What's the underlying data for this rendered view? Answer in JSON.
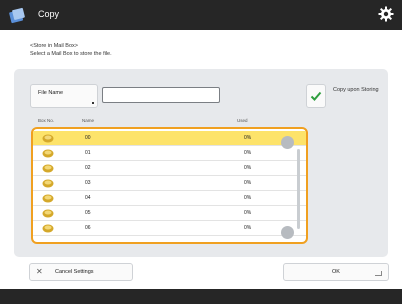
{
  "header": {
    "title": "Copy",
    "icon": "copy-app-icon",
    "settings_icon": "gear-icon"
  },
  "breadcrumb": "<Store in Mail Box>",
  "instruction": "Select a Mail Box to store the file.",
  "file_name": {
    "button_label": "File Name",
    "value": ""
  },
  "copy_upon_storing": {
    "label": "Copy upon Storing",
    "checked": true
  },
  "table": {
    "headers": {
      "box_no": "Box No.",
      "name": "Name",
      "used": "Used"
    },
    "rows": [
      {
        "box_no": "00",
        "name": "",
        "used": "0%"
      },
      {
        "box_no": "01",
        "name": "",
        "used": "0%"
      },
      {
        "box_no": "02",
        "name": "",
        "used": "0%"
      },
      {
        "box_no": "03",
        "name": "",
        "used": "0%"
      },
      {
        "box_no": "04",
        "name": "",
        "used": "0%"
      },
      {
        "box_no": "05",
        "name": "",
        "used": "0%"
      },
      {
        "box_no": "06",
        "name": "",
        "used": "0%"
      }
    ],
    "selected_index": 0
  },
  "footer": {
    "cancel_label": "Cancel Settings",
    "ok_label": "OK"
  },
  "colors": {
    "accent": "#f0a020",
    "selected_row": "#fde36a",
    "check": "#2e9e3e",
    "bar": "#262626"
  }
}
